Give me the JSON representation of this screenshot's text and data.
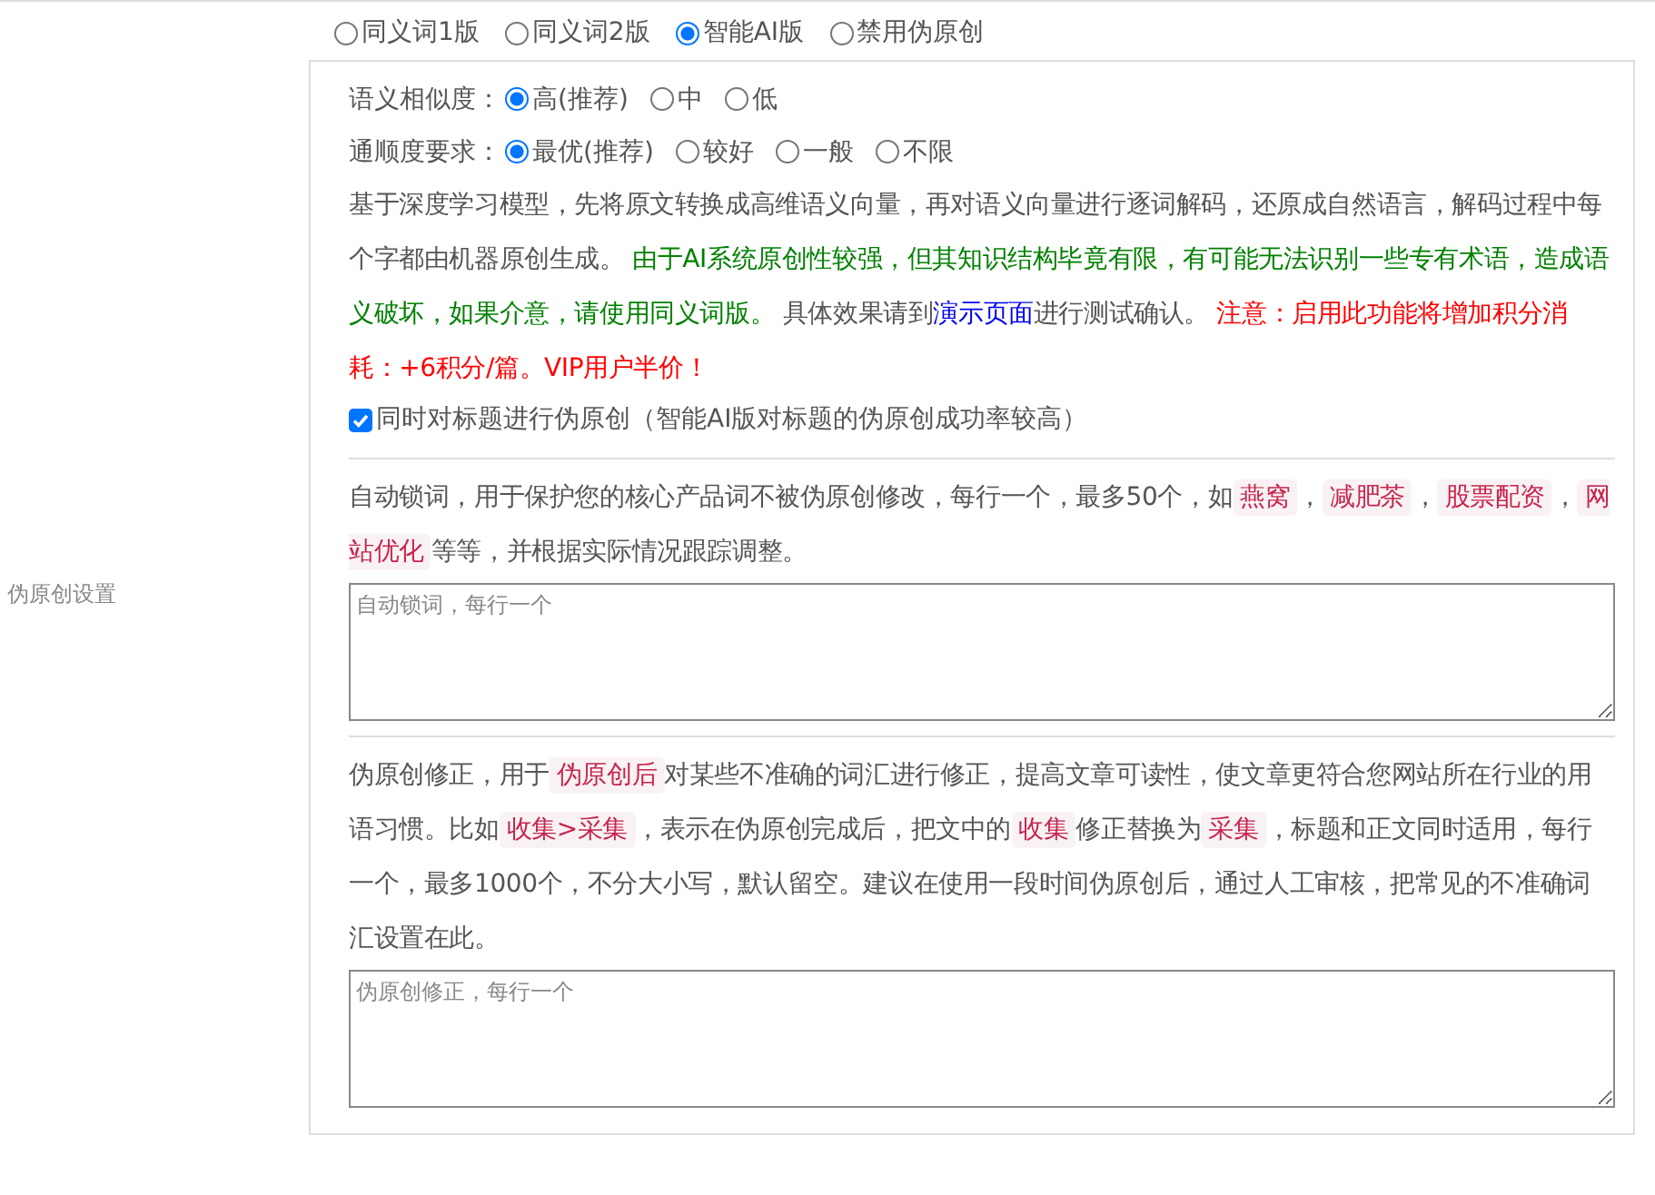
{
  "modes": [
    {
      "label": "同义词1版",
      "selected": false
    },
    {
      "label": "同义词2版",
      "selected": false
    },
    {
      "label": "智能AI版",
      "selected": true
    },
    {
      "label": "禁用伪原创",
      "selected": false
    }
  ],
  "side_label": "伪原创设置",
  "ai_settings": {
    "similarity": {
      "label": "语义相似度：",
      "options": [
        {
          "label": "高(推荐)",
          "selected": true
        },
        {
          "label": "中",
          "selected": false
        },
        {
          "label": "低",
          "selected": false
        }
      ]
    },
    "fluency": {
      "label": "通顺度要求：",
      "options": [
        {
          "label": "最优(推荐)",
          "selected": true
        },
        {
          "label": "较好",
          "selected": false
        },
        {
          "label": "一般",
          "selected": false
        },
        {
          "label": "不限",
          "selected": false
        }
      ]
    },
    "description": [
      {
        "kind": "text",
        "text": "基于深度学习模型，先将原文转换成高维语义向量，再对语义向量进行逐词解码，还原成自然语言，解码过程中每个字都由机器原创生成。 "
      },
      {
        "kind": "note",
        "text": "由于AI系统原创性较强，但其知识结构毕竟有限，有可能无法识别一些专有术语，造成语义破坏，如果介意，请使用同义词版。"
      },
      {
        "kind": "text",
        "text": " 具体效果请到"
      },
      {
        "kind": "link",
        "text": "演示页面"
      },
      {
        "kind": "text",
        "text": "进行测试确认。 "
      },
      {
        "kind": "warning",
        "text": "注意：启用此功能将增加积分消耗：+6积分/篇。VIP用户半价！"
      }
    ],
    "title_option": {
      "label": "同时对标题进行伪原创（智能AI版对标题的伪原创成功率较高）",
      "checked": true
    }
  },
  "lock_words": {
    "description": [
      {
        "kind": "text",
        "text": "自动锁词，用于保护您的核心产品词不被伪原创修改，每行一个，最多50个，如"
      },
      {
        "kind": "tag",
        "text": "燕窝"
      },
      {
        "kind": "text",
        "text": "，"
      },
      {
        "kind": "tag",
        "text": "减肥茶"
      },
      {
        "kind": "text",
        "text": "，"
      },
      {
        "kind": "tag",
        "text": "股票配资"
      },
      {
        "kind": "text",
        "text": "，"
      },
      {
        "kind": "tag",
        "text": "网站优化"
      },
      {
        "kind": "text",
        "text": "等等，并根据实际情况跟踪调整。"
      }
    ],
    "placeholder": "自动锁词，每行一个"
  },
  "corrections": {
    "description": [
      {
        "kind": "text",
        "text": "伪原创修正，用于"
      },
      {
        "kind": "tag",
        "text": "伪原创后"
      },
      {
        "kind": "text",
        "text": "对某些不准确的词汇进行修正，提高文章可读性，使文章更符合您网站所在行业的用语习惯。比如"
      },
      {
        "kind": "tag",
        "text": "收集>采集"
      },
      {
        "kind": "text",
        "text": "，表示在伪原创完成后，把文中的"
      },
      {
        "kind": "tag",
        "text": "收集"
      },
      {
        "kind": "text",
        "text": "修正替换为"
      },
      {
        "kind": "tag",
        "text": "采集"
      },
      {
        "kind": "text",
        "text": "，标题和正文同时适用，每行一个，最多1000个，不分大小写，默认留空。建议在使用一段时间伪原创后，通过人工审核，把常见的不准确词汇设置在此。"
      }
    ],
    "placeholder": "伪原创修正，每行一个"
  }
}
